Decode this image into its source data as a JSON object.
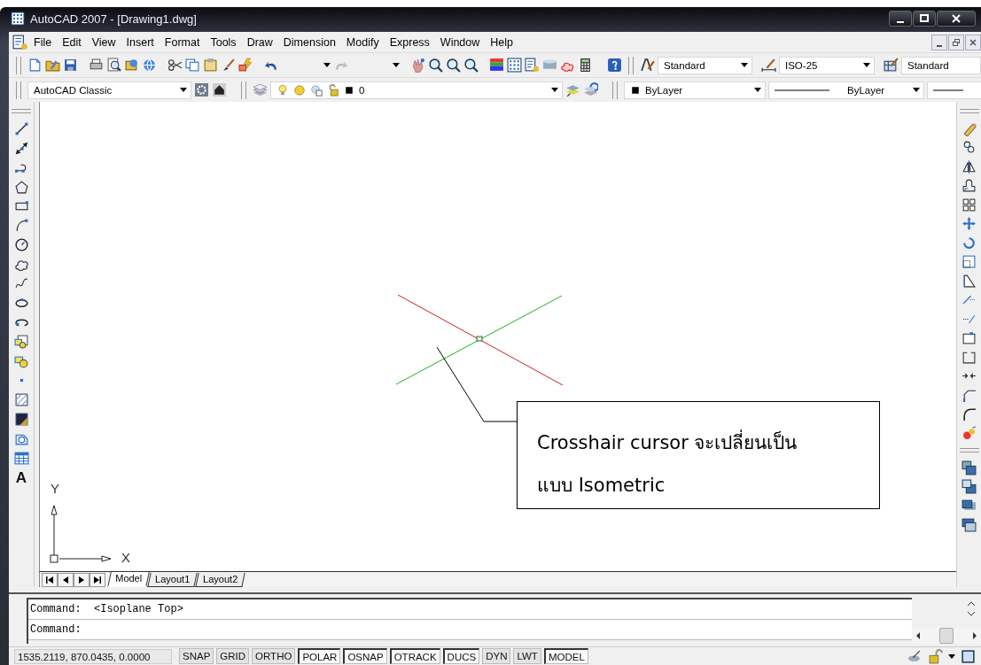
{
  "window": {
    "title": "AutoCAD 2007 - [Drawing1.dwg]"
  },
  "menu": [
    "File",
    "Edit",
    "View",
    "Insert",
    "Format",
    "Tools",
    "Draw",
    "Dimension",
    "Modify",
    "Express",
    "Window",
    "Help"
  ],
  "standard_toolbar": {
    "text_style": "Standard",
    "dim_style": "ISO-25",
    "table_style": "Standard"
  },
  "layers_toolbar": {
    "workspace": "AutoCAD Classic",
    "layer": "0",
    "object_color": "ByLayer",
    "linetype": "ByLayer"
  },
  "draw_toolbar": {
    "text_tool": "A"
  },
  "canvas": {
    "callout": [
      "Crosshair cursor จะเปลี่ยนเป็น",
      "แบบ Isometric"
    ],
    "ucs": {
      "y_label": "Y",
      "x_label": "X"
    }
  },
  "layout_tabs": [
    {
      "label": "Model",
      "selected": true
    },
    {
      "label": "Layout1",
      "selected": false
    },
    {
      "label": "Layout2",
      "selected": false
    }
  ],
  "command_window": {
    "history": "Command:  <Isoplane Top>",
    "prompt": "Command:"
  },
  "status_bar": {
    "coordinates": "1535.2119, 870.0435, 0.0000",
    "toggles": [
      {
        "label": "SNAP",
        "on": false
      },
      {
        "label": "GRID",
        "on": false
      },
      {
        "label": "ORTHO",
        "on": false
      },
      {
        "label": "POLAR",
        "on": true
      },
      {
        "label": "OSNAP",
        "on": true
      },
      {
        "label": "OTRACK",
        "on": true
      },
      {
        "label": "DUCS",
        "on": true
      },
      {
        "label": "DYN",
        "on": false
      },
      {
        "label": "LWT",
        "on": false
      },
      {
        "label": "MODEL",
        "on": true
      }
    ]
  }
}
